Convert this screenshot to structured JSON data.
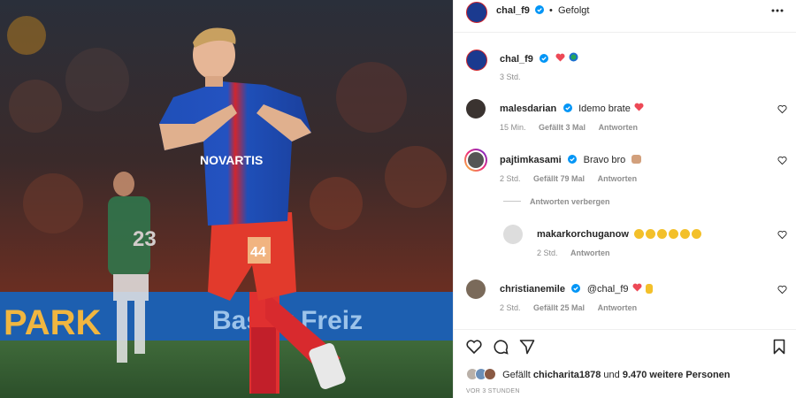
{
  "header": {
    "username": "chal_f9",
    "separator": "•",
    "follow_label": "Gefolgt",
    "more_icon": "more-horizontal-icon"
  },
  "caption": {
    "username": "chal_f9",
    "time": "3 Std."
  },
  "photo": {
    "jersey_text": "NOVARTIS",
    "number": "44",
    "banner_left": "PARK",
    "banner_right": "Basler Freiz",
    "opponent_number": "23"
  },
  "comments": [
    {
      "username": "malesdarian",
      "text": "Idemo brate",
      "time": "15 Min.",
      "likes": "Gefällt 3 Mal",
      "reply": "Antworten"
    },
    {
      "username": "pajtimkasami",
      "text": "Bravo bro",
      "time": "2 Std.",
      "likes": "Gefällt 79 Mal",
      "reply": "Antworten",
      "hide_replies": "Antworten verbergen"
    },
    {
      "username": "makarkorchuganow",
      "text": "",
      "time": "2 Std.",
      "reply": "Antworten"
    },
    {
      "username": "christianemile",
      "text": "@chal_f9",
      "time": "2 Std.",
      "likes": "Gefällt 25 Mal",
      "reply": "Antworten"
    }
  ],
  "likes": {
    "prefix": "Gefällt",
    "user": "chicharita1878",
    "middle": "und",
    "count": "9.470 weitere Personen"
  },
  "timestamp": "VOR 3 STUNDEN",
  "colors": {
    "verified": "#0095f6",
    "heart": "#ed4956",
    "text": "#262626",
    "muted": "#8e8e8e"
  }
}
